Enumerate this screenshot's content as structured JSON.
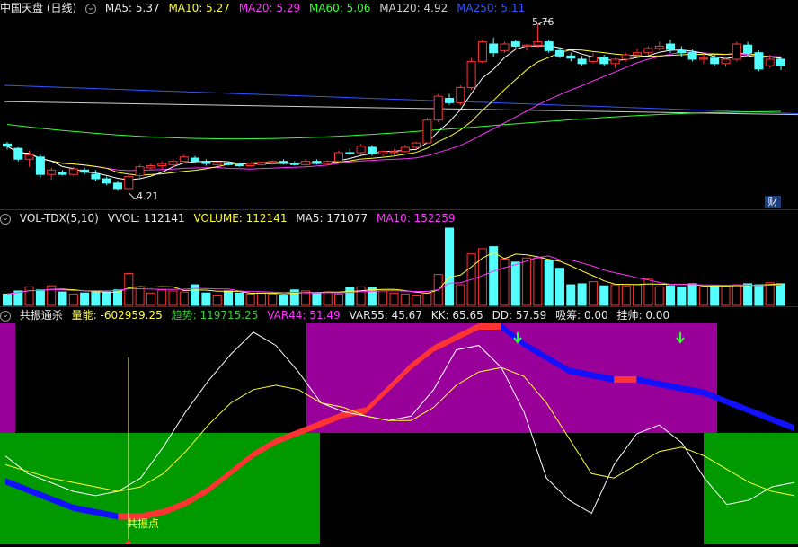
{
  "main_panel": {
    "title": "中国天盘 (日线)",
    "indicators": [
      {
        "label": "MA5: 5.37",
        "color": "#ffffff"
      },
      {
        "label": "MA10: 5.27",
        "color": "#ffff33"
      },
      {
        "label": "MA20: 5.29",
        "color": "#ff33ff"
      },
      {
        "label": "MA60: 5.06",
        "color": "#33ff33"
      },
      {
        "label": "MA120: 4.92",
        "color": "#cfcfcf"
      },
      {
        "label": "MA250: 5.11",
        "color": "#3355ff"
      }
    ],
    "high_label": "5.76",
    "low_label": "4.21",
    "fin_badge": "财"
  },
  "volume_panel": {
    "title": "VOL-TDX(5,10)",
    "indicators": [
      {
        "label": "VVOL: 112141",
        "color": "#ffffff"
      },
      {
        "label": "VOLUME: 112141",
        "color": "#ffff33"
      },
      {
        "label": "MA5: 171077",
        "color": "#ffffff"
      },
      {
        "label": "MA10: 152259",
        "color": "#ff33ff"
      }
    ]
  },
  "signal_panel": {
    "title": "共振通杀",
    "indicators": [
      {
        "label": "量能: -602959.25",
        "color": "#ffff33"
      },
      {
        "label": "趋势: 119715.25",
        "color": "#33cc33"
      },
      {
        "label": "VAR44: 51.49",
        "color": "#ff33ff"
      },
      {
        "label": "VAR55: 45.67",
        "color": "#ffffff"
      },
      {
        "label": "KK: 65.65",
        "color": "#ffffff"
      },
      {
        "label": "DD: 57.59",
        "color": "#ffffff"
      },
      {
        "label": "吸筹: 0.00",
        "color": "#ffffff"
      },
      {
        "label": "挂帅: 0.00",
        "color": "#ffffff"
      }
    ],
    "resonance_label": "共振点"
  },
  "chart_data": {
    "type": "candlestick",
    "high": 5.76,
    "low": 4.21,
    "candles": [
      [
        4.66,
        4.68,
        4.61,
        4.64
      ],
      [
        4.62,
        4.63,
        4.5,
        4.52
      ],
      [
        4.52,
        4.6,
        4.45,
        4.56
      ],
      [
        4.54,
        4.56,
        4.35,
        4.38
      ],
      [
        4.38,
        4.44,
        4.33,
        4.42
      ],
      [
        4.4,
        4.42,
        4.37,
        4.38
      ],
      [
        4.38,
        4.45,
        4.37,
        4.43
      ],
      [
        4.42,
        4.44,
        4.38,
        4.4
      ],
      [
        4.38,
        4.42,
        4.32,
        4.34
      ],
      [
        4.34,
        4.36,
        4.28,
        4.3
      ],
      [
        4.3,
        4.32,
        4.23,
        4.25
      ],
      [
        4.25,
        4.38,
        4.21,
        4.36
      ],
      [
        4.37,
        4.47,
        4.35,
        4.45
      ],
      [
        4.44,
        4.48,
        4.42,
        4.46
      ],
      [
        4.46,
        4.5,
        4.43,
        4.48
      ],
      [
        4.47,
        4.52,
        4.45,
        4.5
      ],
      [
        4.5,
        4.56,
        4.48,
        4.54
      ],
      [
        4.53,
        4.55,
        4.48,
        4.5
      ],
      [
        4.5,
        4.52,
        4.46,
        4.48
      ],
      [
        4.47,
        4.5,
        4.46,
        4.49
      ],
      [
        4.48,
        4.5,
        4.46,
        4.47
      ],
      [
        4.47,
        4.49,
        4.45,
        4.46
      ],
      [
        4.46,
        4.49,
        4.45,
        4.48
      ],
      [
        4.47,
        4.5,
        4.46,
        4.49
      ],
      [
        4.49,
        4.51,
        4.47,
        4.5
      ],
      [
        4.5,
        4.52,
        4.47,
        4.48
      ],
      [
        4.48,
        4.5,
        4.46,
        4.47
      ],
      [
        4.47,
        4.52,
        4.46,
        4.5
      ],
      [
        4.5,
        4.52,
        4.47,
        4.48
      ],
      [
        4.48,
        4.51,
        4.46,
        4.5
      ],
      [
        4.5,
        4.6,
        4.49,
        4.58
      ],
      [
        4.58,
        4.62,
        4.55,
        4.57
      ],
      [
        4.58,
        4.66,
        4.56,
        4.64
      ],
      [
        4.63,
        4.65,
        4.55,
        4.57
      ],
      [
        4.57,
        4.6,
        4.55,
        4.59
      ],
      [
        4.58,
        4.61,
        4.56,
        4.59
      ],
      [
        4.59,
        4.65,
        4.58,
        4.63
      ],
      [
        4.63,
        4.68,
        4.62,
        4.67
      ],
      [
        4.67,
        4.9,
        4.66,
        4.88
      ],
      [
        4.88,
        5.12,
        4.86,
        5.1
      ],
      [
        5.08,
        5.12,
        5.02,
        5.04
      ],
      [
        5.04,
        5.2,
        5.02,
        5.18
      ],
      [
        5.18,
        5.45,
        5.16,
        5.42
      ],
      [
        5.42,
        5.62,
        5.4,
        5.6
      ],
      [
        5.58,
        5.64,
        5.46,
        5.5
      ],
      [
        5.52,
        5.6,
        5.5,
        5.58
      ],
      [
        5.6,
        5.62,
        5.54,
        5.56
      ],
      [
        5.56,
        5.58,
        5.52,
        5.57
      ],
      [
        5.57,
        5.76,
        5.55,
        5.6
      ],
      [
        5.6,
        5.62,
        5.5,
        5.52
      ],
      [
        5.52,
        5.55,
        5.45,
        5.47
      ],
      [
        5.47,
        5.5,
        5.42,
        5.45
      ],
      [
        5.44,
        5.47,
        5.38,
        5.4
      ],
      [
        5.42,
        5.5,
        5.4,
        5.46
      ],
      [
        5.46,
        5.48,
        5.38,
        5.4
      ],
      [
        5.4,
        5.45,
        5.36,
        5.44
      ],
      [
        5.44,
        5.5,
        5.42,
        5.48
      ],
      [
        5.48,
        5.54,
        5.46,
        5.5
      ],
      [
        5.5,
        5.56,
        5.48,
        5.54
      ],
      [
        5.54,
        5.6,
        5.52,
        5.56
      ],
      [
        5.58,
        5.62,
        5.5,
        5.53
      ],
      [
        5.52,
        5.56,
        5.46,
        5.5
      ],
      [
        5.5,
        5.53,
        5.42,
        5.44
      ],
      [
        5.44,
        5.49,
        5.4,
        5.45
      ],
      [
        5.45,
        5.48,
        5.38,
        5.4
      ],
      [
        5.4,
        5.46,
        5.37,
        5.44
      ],
      [
        5.44,
        5.6,
        5.42,
        5.58
      ],
      [
        5.57,
        5.6,
        5.48,
        5.5
      ],
      [
        5.5,
        5.52,
        5.33,
        5.35
      ],
      [
        5.38,
        5.48,
        5.36,
        5.44
      ],
      [
        5.44,
        5.46,
        5.34,
        5.38
      ]
    ],
    "volume": [
      22,
      28,
      36,
      30,
      38,
      26,
      22,
      24,
      28,
      26,
      30,
      62,
      36,
      24,
      30,
      28,
      26,
      40,
      24,
      20,
      28,
      24,
      22,
      24,
      22,
      20,
      30,
      28,
      24,
      26,
      22,
      34,
      36,
      34,
      28,
      24,
      22,
      20,
      24,
      60,
      150,
      40,
      100,
      110,
      114,
      90,
      84,
      92,
      92,
      88,
      72,
      40,
      42,
      46,
      38,
      40,
      38,
      40,
      52,
      36,
      38,
      36,
      42,
      36,
      38,
      36,
      40,
      42,
      40,
      44,
      42
    ],
    "ma_labels": {
      "MA5": 5.37,
      "MA10": 5.27,
      "MA20": 5.29,
      "MA60": 5.06,
      "MA120": 4.92,
      "MA250": 5.11
    },
    "vol_labels": {
      "VVOL": 112141,
      "VOLUME": 112141,
      "MA5": 171077,
      "MA10": 152259
    },
    "signal_labels": {
      "量能": -602959.25,
      "趋势": 119715.25,
      "VAR44": 51.49,
      "VAR55": 45.67,
      "KK": 65.65,
      "DD": 57.59,
      "吸筹": 0.0,
      "挂帅": 0.0
    },
    "kk": [
      40,
      32,
      28,
      24,
      22,
      24,
      30,
      44,
      60,
      74,
      86,
      96,
      90,
      78,
      64,
      60,
      58,
      56,
      58,
      70,
      88,
      90,
      80,
      60,
      30,
      20,
      14,
      36,
      50,
      54,
      46,
      30,
      18,
      20,
      26,
      28
    ],
    "dd": [
      36,
      33,
      30,
      28,
      26,
      24,
      26,
      32,
      42,
      54,
      64,
      70,
      72,
      70,
      64,
      62,
      58,
      56,
      56,
      62,
      72,
      78,
      80,
      76,
      64,
      48,
      32,
      30,
      36,
      42,
      44,
      40,
      34,
      28,
      24,
      22
    ],
    "trend_line": [
      30,
      26,
      22,
      18,
      16,
      14,
      14,
      16,
      20,
      26,
      34,
      42,
      48,
      52,
      56,
      60,
      62,
      72,
      82,
      90,
      95,
      100,
      100,
      92,
      86,
      80,
      78,
      76,
      76,
      74,
      72,
      70,
      66,
      62,
      58,
      54
    ]
  }
}
